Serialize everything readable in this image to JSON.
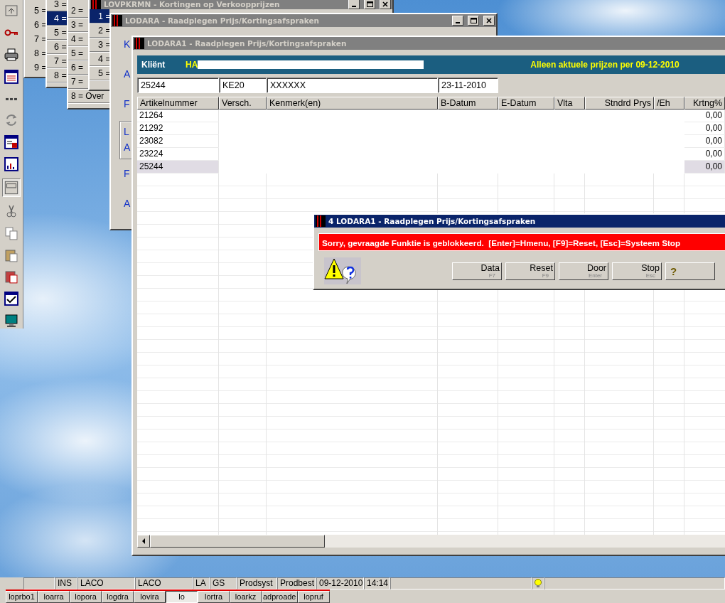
{
  "menus": [
    {
      "items": [
        {
          "label": "5 =",
          "selected": false
        },
        {
          "label": "6 =",
          "selected": false
        },
        {
          "label": "7 =",
          "selected": false
        },
        {
          "label": "8 =",
          "selected": false
        },
        {
          "label": "9 =",
          "selected": false
        }
      ]
    },
    {
      "items": [
        {
          "label": "3 =",
          "selected": false
        },
        {
          "label": "4 =",
          "selected": true
        },
        {
          "label": "5 =",
          "selected": false
        },
        {
          "label": "6 =",
          "selected": false
        },
        {
          "label": "7 =",
          "selected": false
        },
        {
          "label": "8 =",
          "selected": false
        }
      ]
    },
    {
      "items": [
        {
          "label": "2 =",
          "selected": false
        },
        {
          "label": "3 =",
          "selected": false
        },
        {
          "label": "4 =",
          "selected": false
        },
        {
          "label": "5 =",
          "selected": false
        },
        {
          "label": "6 =",
          "selected": false
        },
        {
          "label": "7 =",
          "selected": false
        },
        {
          "label": "8 = Over",
          "selected": false
        }
      ]
    },
    {
      "title": "LOVPKRMN - Kortingen op Verkoopprijzen",
      "items": [
        {
          "label": "1 =",
          "selected": true
        },
        {
          "label": "2 =",
          "selected": false
        },
        {
          "label": "3 =",
          "selected": false
        },
        {
          "label": "4 =",
          "selected": false
        },
        {
          "label": "5 =",
          "selected": false
        }
      ]
    }
  ],
  "lodara": {
    "title": "LODARA - Raadplegen Prijs/Kortingsafspraken",
    "labels": [
      {
        "text": "K",
        "kind": "plain"
      },
      {
        "text": "A",
        "kind": "plain"
      },
      {
        "text": "F",
        "kind": "plain"
      },
      {
        "text": "L",
        "kind": "grouped"
      },
      {
        "text": "A",
        "kind": "grouped"
      },
      {
        "text": "F",
        "kind": "plain"
      },
      {
        "text": "A",
        "kind": "plain"
      }
    ]
  },
  "lodara1": {
    "title": "LODARA1 - Raadplegen Prijs/Kortingsafspraken",
    "header": {
      "label": "Kliënt",
      "client": "HA",
      "note": "Alleen aktuele prijzen per 09-12-2010"
    },
    "fields": [
      "25244",
      "KE20",
      "XXXXXX",
      "23-11-2010"
    ],
    "table": {
      "columns": [
        "Artikelnummer",
        "Versch.",
        "Kenmerk(en)",
        "B-Datum",
        "E-Datum",
        "Vlta",
        "Stndrd Prys",
        "/Eh",
        "Krtng%"
      ],
      "rows": [
        {
          "artikelnummer": "21264",
          "krtng": "0,00",
          "selected": false
        },
        {
          "artikelnummer": "21292",
          "krtng": "0,00",
          "selected": false
        },
        {
          "artikelnummer": "23082",
          "krtng": "0,00",
          "selected": false
        },
        {
          "artikelnummer": "23224",
          "krtng": "0,00",
          "selected": false
        },
        {
          "artikelnummer": "25244",
          "krtng": "0,00",
          "selected": true
        }
      ]
    }
  },
  "dialog": {
    "title": "4 LODARA1 - Raadplegen Prijs/Kortingsafspraken",
    "message": "Sorry, gevraagde Funktie is geblokkeerd.  [Enter]=Hmenu, [F9]=Reset, [Esc]=Systeem Stop",
    "buttons": [
      {
        "kind": "command",
        "label": "Data",
        "key": "F7"
      },
      {
        "kind": "command",
        "label": "Reset",
        "key": "F9"
      },
      {
        "kind": "command",
        "label": "Door",
        "key": "Enter"
      },
      {
        "kind": "command",
        "label": "Stop",
        "key": "Esc"
      },
      {
        "kind": "help",
        "label": "?"
      }
    ]
  },
  "status_bar": {
    "cells": [
      {
        "kind": "blank"
      },
      {
        "kind": "text",
        "text": "INS"
      },
      {
        "kind": "text",
        "text": "LACO"
      },
      {
        "kind": "text",
        "text": "LACO"
      },
      {
        "kind": "text",
        "text": "LA"
      },
      {
        "kind": "text",
        "text": "GS"
      },
      {
        "kind": "text",
        "text": "Prodsyst"
      },
      {
        "kind": "text",
        "text": "Prodbest"
      },
      {
        "kind": "text",
        "text": "09-12-2010"
      },
      {
        "kind": "text",
        "text": "14:14"
      },
      {
        "kind": "blank"
      },
      {
        "kind": "bulb"
      },
      {
        "kind": "blank"
      }
    ]
  },
  "taskbar": {
    "tabs": [
      {
        "label": "loprbo1",
        "selected": false
      },
      {
        "label": "loarra",
        "selected": false
      },
      {
        "label": "lopora",
        "selected": false
      },
      {
        "label": "logdra",
        "selected": false
      },
      {
        "label": "lovira",
        "selected": false
      },
      {
        "label": "lo",
        "selected": true
      },
      {
        "label": "lortra",
        "selected": false
      },
      {
        "label": "loarkz",
        "selected": false
      },
      {
        "label": "adproade",
        "selected": false
      },
      {
        "label": "lopruf",
        "selected": false
      }
    ]
  }
}
